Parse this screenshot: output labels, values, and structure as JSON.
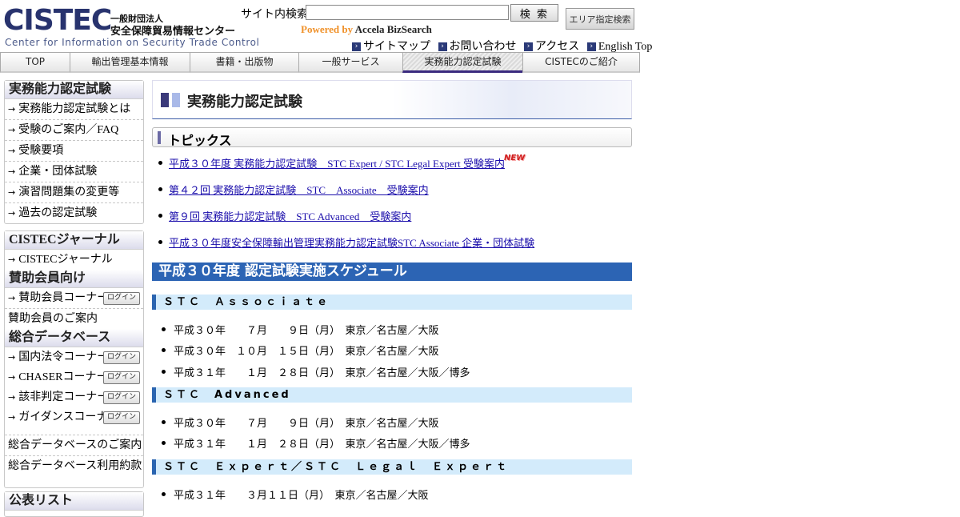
{
  "header": {
    "logo_main": "CISTEC",
    "logo_jp_line1": "一般財団法人",
    "logo_jp_line2": "安全保障貿易情報センター",
    "logo_en": "Center for Information on Security Trade Control",
    "search_label": "サイト内検索",
    "search_value": "",
    "search_button": "検 索",
    "area_search_button": "エリア指定検索",
    "powered_prefix": "Powered by",
    "powered_name": "Accela BizSearch",
    "util_links": [
      "サイトマップ",
      "お問い合わせ",
      "アクセス",
      "English Top"
    ]
  },
  "nav": {
    "tabs": [
      "TOP",
      "輸出管理基本情報",
      "書籍・出版物",
      "一般サービス",
      "実務能力認定試験",
      "CISTECのご紹介"
    ],
    "active_index": 4
  },
  "sidebar": {
    "exam": {
      "title": "実務能力認定試験",
      "items": [
        "実務能力認定試験とは",
        "受験のご案内／FAQ",
        "受験要項",
        "企業・団体試験",
        "演習問題集の変更等",
        "過去の認定試験"
      ]
    },
    "journal": {
      "title": "CISTECジャーナル",
      "items": [
        "CISTECジャーナル"
      ]
    },
    "members": {
      "title": "賛助会員向け",
      "corner": "賛助会員コーナー",
      "guide": "賛助会員のご案内"
    },
    "database": {
      "title": "総合データベース",
      "corners": [
        "国内法令コーナー",
        "CHASERコーナー",
        "該非判定コーナー",
        "ガイダンスコーナー"
      ],
      "guide": "総合データベースのご案内",
      "terms": "総合データベース利用約款"
    },
    "login_label": "ログイン",
    "next_title": "公表リスト"
  },
  "main": {
    "page_title": "実務能力認定試験",
    "topics_title": "トピックス",
    "topics": [
      "平成３０年度 実務能力認定試験　STC Expert / STC Legal Expert 受験案内",
      "第４２回 実務能力認定試験　STC　Associate　受験案内",
      "第９回 実務能力認定試験　STC Advanced　受験案内",
      "平成３０年度安全保障輸出管理実務能力認定試験STC Associate 企業・団体試験"
    ],
    "new_badge": "NEW",
    "schedule_title": "平成３０年度 認定試験実施スケジュール",
    "sections": [
      {
        "title": "ＳＴＣ　Ａｓｓｏｃｉａｔｅ",
        "entries": [
          "平成３０年　　７月　　９日（月）　東京／名古屋／大阪",
          "平成３０年　１０月　１５日（月）　東京／名古屋／大阪",
          "平成３１年　　１月　２８日（月）　東京／名古屋／大阪／博多"
        ]
      },
      {
        "title": "ＳＴＣ　Advanced",
        "entries": [
          "平成３０年　　７月　　９日（月）　東京／名古屋／大阪",
          "平成３１年　　１月　２８日（月）　東京／名古屋／大阪／博多"
        ]
      },
      {
        "title": "ＳＴＣ　Ｅｘｐｅｒｔ／ＳＴＣ　Ｌｅｇａｌ　Ｅｘｐｅｒｔ",
        "entries": [
          "平成３１年　　３月１１日（月）　東京／名古屋／大阪"
        ]
      }
    ]
  },
  "colors": {
    "brand_navy": "#28336e",
    "schedule_blue": "#2c64b4",
    "subhead_bg": "#d3ebfb",
    "link": "#1a0dab",
    "powered_orange": "#f0922b"
  }
}
